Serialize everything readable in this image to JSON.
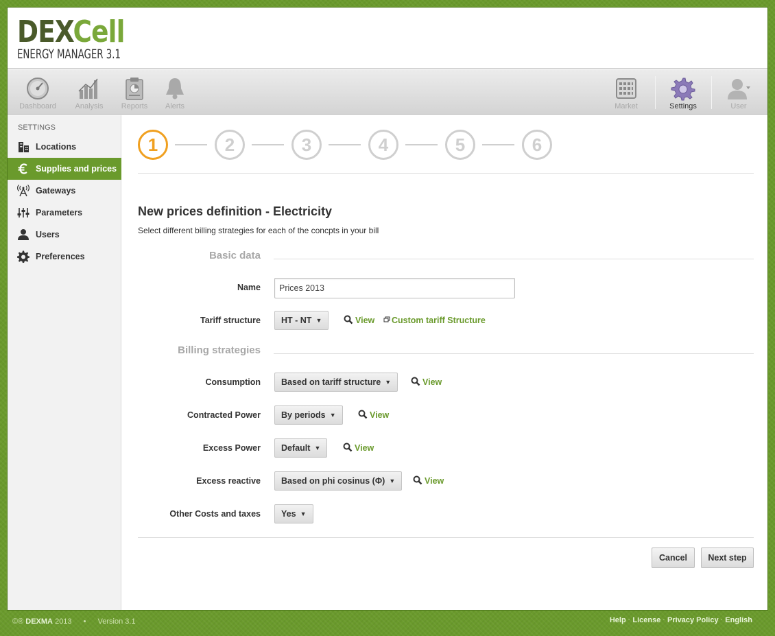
{
  "logo": {
    "brand_dark": "DEX",
    "brand_light": "Cell",
    "subtitle": "ENERGY MANAGER 3.1"
  },
  "nav": {
    "left": [
      {
        "label": "Dashboard",
        "icon": "dashboard-gauge-icon"
      },
      {
        "label": "Analysis",
        "icon": "analysis-bars-icon"
      },
      {
        "label": "Reports",
        "icon": "reports-clipboard-icon"
      },
      {
        "label": "Alerts",
        "icon": "alerts-bell-icon"
      }
    ],
    "right": [
      {
        "label": "Market",
        "icon": "market-grid-icon"
      },
      {
        "label": "Settings",
        "icon": "settings-gear-icon"
      },
      {
        "label": "User",
        "icon": "user-avatar-icon"
      }
    ]
  },
  "sidebar": {
    "heading": "SETTINGS",
    "items": [
      {
        "label": "Locations",
        "icon": "buildings-icon"
      },
      {
        "label": "Supplies and prices",
        "icon": "euro-icon"
      },
      {
        "label": "Gateways",
        "icon": "antenna-icon"
      },
      {
        "label": "Parameters",
        "icon": "sliders-icon"
      },
      {
        "label": "Users",
        "icon": "user-icon"
      },
      {
        "label": "Preferences",
        "icon": "gear-icon"
      }
    ]
  },
  "steps": [
    "1",
    "2",
    "3",
    "4",
    "5",
    "6"
  ],
  "form": {
    "title": "New prices definition - Electricity",
    "description": "Select different billing strategies for each of the concpts in your bill",
    "basic_section": "Basic data",
    "billing_section": "Billing strategies",
    "name_label": "Name",
    "name_value": "Prices 2013",
    "tariff_label": "Tariff structure",
    "tariff_value": "HT - NT",
    "view_label": "View",
    "custom_tariff_label": "Custom tariff Structure",
    "consumption_label": "Consumption",
    "consumption_value": "Based on tariff structure",
    "contracted_label": "Contracted Power",
    "contracted_value": "By periods",
    "excess_power_label": "Excess Power",
    "excess_power_value": "Default",
    "excess_reactive_label": "Excess reactive",
    "excess_reactive_value": "Based on phi cosinus (Φ)",
    "other_costs_label": "Other Costs and taxes",
    "other_costs_value": "Yes",
    "caret": "▼",
    "cancel_label": "Cancel",
    "next_label": "Next step"
  },
  "footer": {
    "copyright": "©® ",
    "company": "DEXMA",
    "year": " 2013",
    "separator": "•",
    "version": "Version 3.1",
    "links": [
      "Help",
      "License",
      "Privacy Policy",
      "English"
    ]
  },
  "colors": {
    "accent": "#6a9a2c",
    "current_step": "#f0a020",
    "muted_step": "#cfcfcf"
  }
}
